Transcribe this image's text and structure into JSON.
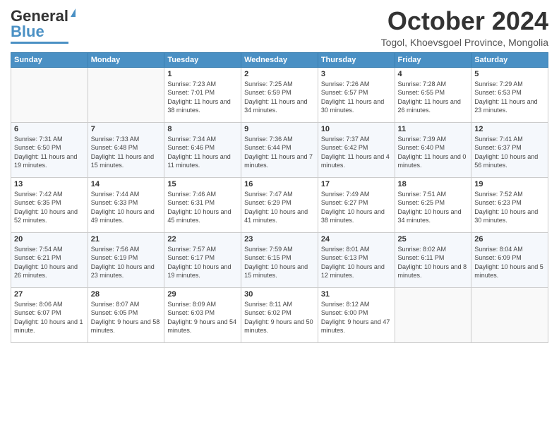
{
  "header": {
    "logo_line1": "General",
    "logo_line2": "Blue",
    "month": "October 2024",
    "location": "Togol, Khoevsgoel Province, Mongolia"
  },
  "days_of_week": [
    "Sunday",
    "Monday",
    "Tuesday",
    "Wednesday",
    "Thursday",
    "Friday",
    "Saturday"
  ],
  "weeks": [
    [
      {
        "day": "",
        "content": ""
      },
      {
        "day": "",
        "content": ""
      },
      {
        "day": "1",
        "content": "Sunrise: 7:23 AM\nSunset: 7:01 PM\nDaylight: 11 hours and 38 minutes."
      },
      {
        "day": "2",
        "content": "Sunrise: 7:25 AM\nSunset: 6:59 PM\nDaylight: 11 hours and 34 minutes."
      },
      {
        "day": "3",
        "content": "Sunrise: 7:26 AM\nSunset: 6:57 PM\nDaylight: 11 hours and 30 minutes."
      },
      {
        "day": "4",
        "content": "Sunrise: 7:28 AM\nSunset: 6:55 PM\nDaylight: 11 hours and 26 minutes."
      },
      {
        "day": "5",
        "content": "Sunrise: 7:29 AM\nSunset: 6:53 PM\nDaylight: 11 hours and 23 minutes."
      }
    ],
    [
      {
        "day": "6",
        "content": "Sunrise: 7:31 AM\nSunset: 6:50 PM\nDaylight: 11 hours and 19 minutes."
      },
      {
        "day": "7",
        "content": "Sunrise: 7:33 AM\nSunset: 6:48 PM\nDaylight: 11 hours and 15 minutes."
      },
      {
        "day": "8",
        "content": "Sunrise: 7:34 AM\nSunset: 6:46 PM\nDaylight: 11 hours and 11 minutes."
      },
      {
        "day": "9",
        "content": "Sunrise: 7:36 AM\nSunset: 6:44 PM\nDaylight: 11 hours and 7 minutes."
      },
      {
        "day": "10",
        "content": "Sunrise: 7:37 AM\nSunset: 6:42 PM\nDaylight: 11 hours and 4 minutes."
      },
      {
        "day": "11",
        "content": "Sunrise: 7:39 AM\nSunset: 6:40 PM\nDaylight: 11 hours and 0 minutes."
      },
      {
        "day": "12",
        "content": "Sunrise: 7:41 AM\nSunset: 6:37 PM\nDaylight: 10 hours and 56 minutes."
      }
    ],
    [
      {
        "day": "13",
        "content": "Sunrise: 7:42 AM\nSunset: 6:35 PM\nDaylight: 10 hours and 52 minutes."
      },
      {
        "day": "14",
        "content": "Sunrise: 7:44 AM\nSunset: 6:33 PM\nDaylight: 10 hours and 49 minutes."
      },
      {
        "day": "15",
        "content": "Sunrise: 7:46 AM\nSunset: 6:31 PM\nDaylight: 10 hours and 45 minutes."
      },
      {
        "day": "16",
        "content": "Sunrise: 7:47 AM\nSunset: 6:29 PM\nDaylight: 10 hours and 41 minutes."
      },
      {
        "day": "17",
        "content": "Sunrise: 7:49 AM\nSunset: 6:27 PM\nDaylight: 10 hours and 38 minutes."
      },
      {
        "day": "18",
        "content": "Sunrise: 7:51 AM\nSunset: 6:25 PM\nDaylight: 10 hours and 34 minutes."
      },
      {
        "day": "19",
        "content": "Sunrise: 7:52 AM\nSunset: 6:23 PM\nDaylight: 10 hours and 30 minutes."
      }
    ],
    [
      {
        "day": "20",
        "content": "Sunrise: 7:54 AM\nSunset: 6:21 PM\nDaylight: 10 hours and 26 minutes."
      },
      {
        "day": "21",
        "content": "Sunrise: 7:56 AM\nSunset: 6:19 PM\nDaylight: 10 hours and 23 minutes."
      },
      {
        "day": "22",
        "content": "Sunrise: 7:57 AM\nSunset: 6:17 PM\nDaylight: 10 hours and 19 minutes."
      },
      {
        "day": "23",
        "content": "Sunrise: 7:59 AM\nSunset: 6:15 PM\nDaylight: 10 hours and 15 minutes."
      },
      {
        "day": "24",
        "content": "Sunrise: 8:01 AM\nSunset: 6:13 PM\nDaylight: 10 hours and 12 minutes."
      },
      {
        "day": "25",
        "content": "Sunrise: 8:02 AM\nSunset: 6:11 PM\nDaylight: 10 hours and 8 minutes."
      },
      {
        "day": "26",
        "content": "Sunrise: 8:04 AM\nSunset: 6:09 PM\nDaylight: 10 hours and 5 minutes."
      }
    ],
    [
      {
        "day": "27",
        "content": "Sunrise: 8:06 AM\nSunset: 6:07 PM\nDaylight: 10 hours and 1 minute."
      },
      {
        "day": "28",
        "content": "Sunrise: 8:07 AM\nSunset: 6:05 PM\nDaylight: 9 hours and 58 minutes."
      },
      {
        "day": "29",
        "content": "Sunrise: 8:09 AM\nSunset: 6:03 PM\nDaylight: 9 hours and 54 minutes."
      },
      {
        "day": "30",
        "content": "Sunrise: 8:11 AM\nSunset: 6:02 PM\nDaylight: 9 hours and 50 minutes."
      },
      {
        "day": "31",
        "content": "Sunrise: 8:12 AM\nSunset: 6:00 PM\nDaylight: 9 hours and 47 minutes."
      },
      {
        "day": "",
        "content": ""
      },
      {
        "day": "",
        "content": ""
      }
    ]
  ]
}
